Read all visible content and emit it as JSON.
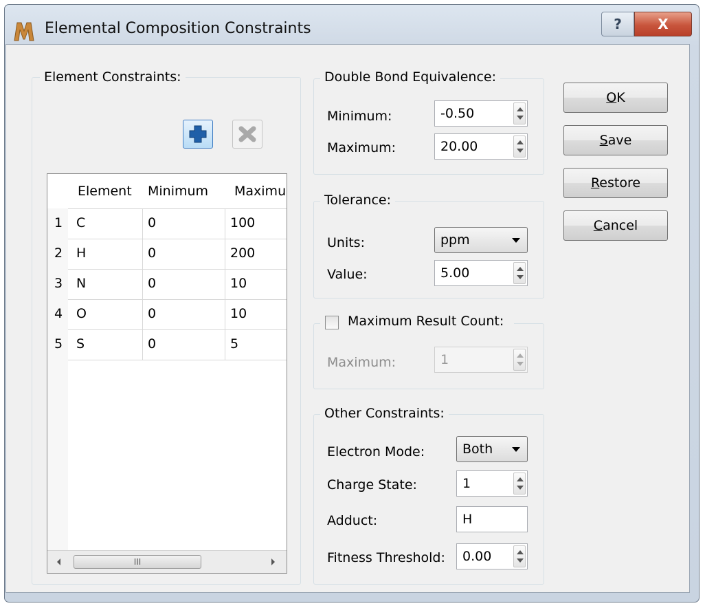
{
  "window": {
    "title": "Elemental Composition Constraints",
    "help_glyph": "?",
    "close_glyph": "X"
  },
  "elements_panel": {
    "title": "Element Constraints:",
    "add_icon": "plus-icon",
    "remove_icon": "x-icon",
    "columns": [
      "Element",
      "Minimum",
      "Maximu"
    ],
    "rows": [
      {
        "num": "1",
        "element": "C",
        "min": "0",
        "max": "100"
      },
      {
        "num": "2",
        "element": "H",
        "min": "0",
        "max": "200"
      },
      {
        "num": "3",
        "element": "N",
        "min": "0",
        "max": "10"
      },
      {
        "num": "4",
        "element": "O",
        "min": "0",
        "max": "10"
      },
      {
        "num": "5",
        "element": "S",
        "min": "0",
        "max": "5"
      }
    ],
    "scroll_thumb_glyph": "III"
  },
  "dbe": {
    "title": "Double Bond Equivalence:",
    "min_label": "Minimum:",
    "min_value": "-0.50",
    "max_label": "Maximum:",
    "max_value": "20.00"
  },
  "tolerance": {
    "title": "Tolerance:",
    "units_label": "Units:",
    "units_value": "ppm",
    "value_label": "Value:",
    "value": "5.00"
  },
  "max_result": {
    "title": "Maximum Result Count:",
    "checked": false,
    "max_label": "Maximum:",
    "max_value": "1"
  },
  "other": {
    "title": "Other Constraints:",
    "electron_label": "Electron Mode:",
    "electron_value": "Both",
    "charge_label": "Charge State:",
    "charge_value": "1",
    "adduct_label": "Adduct:",
    "adduct_value": "H",
    "fitness_label": "Fitness Threshold:",
    "fitness_value": "0.00"
  },
  "buttons": {
    "ok": {
      "first": "O",
      "rest": "K"
    },
    "save": {
      "first": "S",
      "rest": "ave"
    },
    "restore": {
      "first": "R",
      "rest": "estore"
    },
    "cancel": {
      "first": "C",
      "rest": "ancel"
    }
  }
}
